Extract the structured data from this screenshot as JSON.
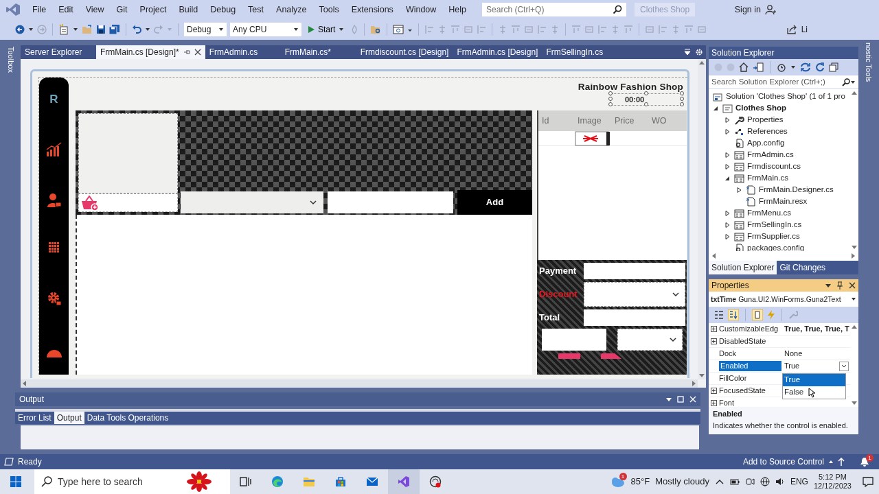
{
  "menu_bar": {
    "items": [
      "File",
      "Edit",
      "View",
      "Git",
      "Project",
      "Build",
      "Debug",
      "Test",
      "Analyze",
      "Tools",
      "Extensions",
      "Window",
      "Help"
    ],
    "search": {
      "placeholder": "Search (Ctrl+Q)"
    },
    "solution_name": "Clothes Shop",
    "sign_in": "Sign in"
  },
  "toolbar": {
    "configuration": "Debug",
    "platform": "Any CPU",
    "start": "Start",
    "live_share": "Li"
  },
  "toolbox_tab": "Toolbox",
  "document_tabs": [
    {
      "label": "Server Explorer",
      "selected": false
    },
    {
      "label": "FrmMain.cs [Design]*",
      "selected": true
    },
    {
      "label": "FrmAdmin.cs",
      "selected": false
    },
    {
      "label": "FrmMain.cs*",
      "selected": false
    },
    {
      "label": "Frmdiscount.cs [Design]",
      "selected": false
    },
    {
      "label": "FrmAdmin.cs [Design]",
      "selected": false
    },
    {
      "label": "FrmSellingIn.cs",
      "selected": false
    }
  ],
  "designer": {
    "logo": "R",
    "title": "Rainbow Fashion Shop",
    "time_field": {
      "value": "00:00",
      "selected": true
    },
    "add_button": "Add",
    "grid_columns": [
      "Id",
      "Image",
      "Price",
      "WO"
    ],
    "payment_label": "Payment",
    "discount_label": "Discount",
    "total_label": "Total"
  },
  "output_panel": {
    "title": "Output",
    "tabs": [
      {
        "label": "Error List",
        "selected": false
      },
      {
        "label": "Output",
        "selected": true
      },
      {
        "label": "Data Tools Operations",
        "selected": false
      }
    ]
  },
  "solution_explorer": {
    "title": "Solution Explorer",
    "search": {
      "placeholder": "Search Solution Explorer (Ctrl+;)"
    },
    "tree": [
      {
        "label": "Solution 'Clothes Shop' (1 of 1 pro",
        "kind": "solution",
        "children": [
          {
            "label": "Clothes Shop",
            "kind": "project",
            "expanded": true,
            "children": [
              {
                "label": "Properties",
                "kind": "properties",
                "expanded": false
              },
              {
                "label": "References",
                "kind": "references",
                "expanded": false
              },
              {
                "label": "App.config",
                "kind": "config"
              },
              {
                "label": "FrmAdmin.cs",
                "kind": "form",
                "expanded": false
              },
              {
                "label": "Frmdiscount.cs",
                "kind": "form",
                "expanded": false
              },
              {
                "label": "FrmMain.cs",
                "kind": "form",
                "expanded": true,
                "children": [
                  {
                    "label": "FrmMain.Designer.cs",
                    "kind": "file",
                    "expanded": false
                  },
                  {
                    "label": "FrmMain.resx",
                    "kind": "file"
                  }
                ]
              },
              {
                "label": "FrmMenu.cs",
                "kind": "form",
                "expanded": false
              },
              {
                "label": "FrmSellingIn.cs",
                "kind": "form",
                "expanded": false
              },
              {
                "label": "FrmSupplier.cs",
                "kind": "form",
                "expanded": false
              },
              {
                "label": "packages.config",
                "kind": "config"
              }
            ]
          }
        ]
      }
    ],
    "tabs": [
      {
        "label": "Solution Explorer",
        "selected": true
      },
      {
        "label": "Git Changes",
        "selected": false
      }
    ]
  },
  "properties": {
    "title": "Properties",
    "object": "txtTime",
    "type": "Guna.UI2.WinForms.Guna2Text",
    "rows": [
      {
        "name": "CustomizableEdg",
        "value": "True, True, True, T",
        "expandable": true,
        "selected": false,
        "modified": true
      },
      {
        "name": "DisabledState",
        "expandable": true,
        "selected": false
      },
      {
        "name": "Dock",
        "value": "None",
        "expandable": false,
        "selected": false,
        "modified": false
      },
      {
        "name": "Enabled",
        "value": "True",
        "expandable": false,
        "selected": true,
        "modified": false
      },
      {
        "name": "FillColor",
        "expandable": false,
        "selected": false
      },
      {
        "name": "FocusedState",
        "expandable": true,
        "selected": false
      },
      {
        "name": "Font",
        "expandable": true,
        "selected": false
      }
    ],
    "dropdown": [
      {
        "label": "True",
        "selected": true
      },
      {
        "label": "False",
        "selected": false
      }
    ],
    "description_title": "Enabled",
    "description": "Indicates whether the control is enabled."
  },
  "side_tab": "nostic Tools",
  "status_bar": {
    "text": "Ready",
    "source_control": "Add to Source Control",
    "notifications": "1"
  },
  "taskbar": {
    "search": {
      "placeholder": "Type here to search"
    },
    "weather_badge": "1",
    "temperature": "85°F",
    "condition": "Mostly cloudy",
    "language": "ENG",
    "time": "5:12 PM",
    "date": "12/12/2023"
  }
}
